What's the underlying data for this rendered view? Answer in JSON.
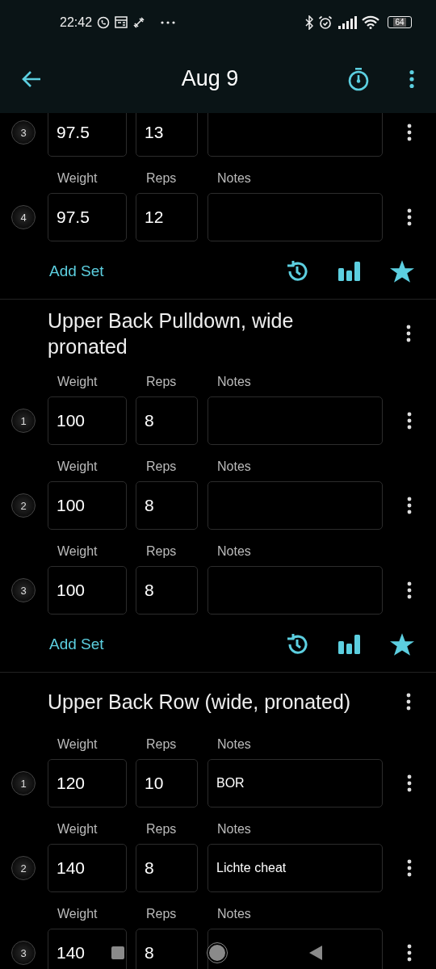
{
  "status_bar": {
    "time": "22:42",
    "battery": "64"
  },
  "app_bar": {
    "title": "Aug 9"
  },
  "exercises": [
    {
      "sets": [
        {
          "number": "3",
          "weight": "97.5",
          "reps": "13"
        },
        {
          "number": "4",
          "labels": {
            "weight": "Weight",
            "reps": "Reps",
            "notes": "Notes"
          },
          "weight": "97.5",
          "reps": "12"
        }
      ],
      "add_set": "Add Set"
    },
    {
      "name": "Upper Back Pulldown, wide pronated",
      "sets": [
        {
          "number": "1",
          "labels": {
            "weight": "Weight",
            "reps": "Reps",
            "notes": "Notes"
          },
          "weight": "100",
          "reps": "8"
        },
        {
          "number": "2",
          "labels": {
            "weight": "Weight",
            "reps": "Reps",
            "notes": "Notes"
          },
          "weight": "100",
          "reps": "8"
        },
        {
          "number": "3",
          "labels": {
            "weight": "Weight",
            "reps": "Reps",
            "notes": "Notes"
          },
          "weight": "100",
          "reps": "8"
        }
      ],
      "add_set": "Add Set"
    },
    {
      "name": "Upper Back Row (wide, pronated)",
      "sets": [
        {
          "number": "1",
          "labels": {
            "weight": "Weight",
            "reps": "Reps",
            "notes": "Notes"
          },
          "weight": "120",
          "reps": "10",
          "notes": "BOR"
        },
        {
          "number": "2",
          "labels": {
            "weight": "Weight",
            "reps": "Reps",
            "notes": "Notes"
          },
          "weight": "140",
          "reps": "8",
          "notes": "Lichte cheat"
        },
        {
          "number": "3",
          "labels": {
            "weight": "Weight",
            "reps": "Reps",
            "notes": "Notes"
          },
          "weight": "140",
          "reps": "8"
        }
      ]
    }
  ]
}
